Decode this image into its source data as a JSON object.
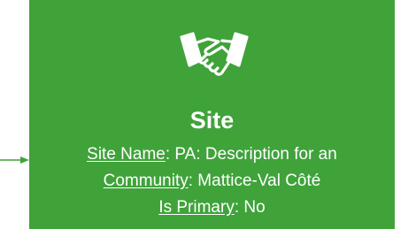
{
  "colors": {
    "card_background": "#3fa33a",
    "connector": "#3fa33a",
    "text": "#ffffff"
  },
  "card": {
    "icon": "handshake-icon",
    "title": "Site",
    "fields": [
      {
        "label": "Site Name",
        "separator": ": ",
        "value": "PA: Description for an"
      },
      {
        "label": "Community",
        "separator": ": ",
        "value": "Mattice-Val Côté"
      },
      {
        "label": "Is Primary",
        "separator": ": ",
        "value": "No"
      }
    ]
  }
}
